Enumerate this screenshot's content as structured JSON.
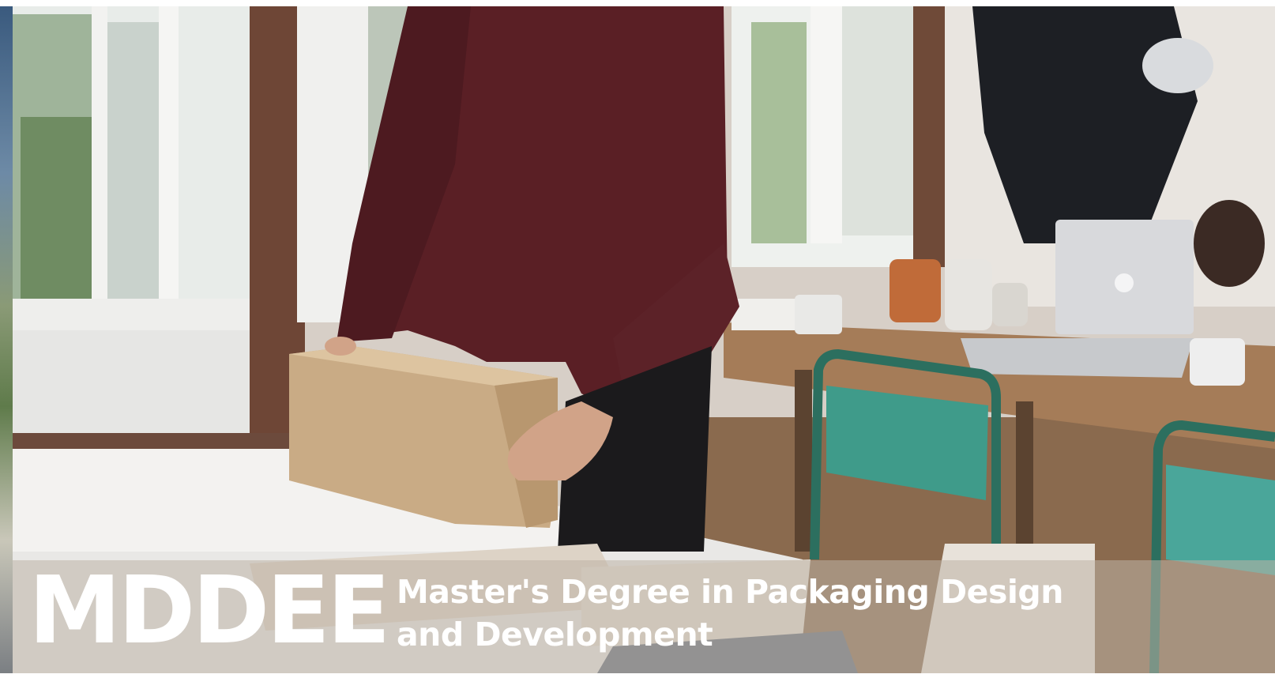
{
  "banner": {
    "brand": "MDDEE",
    "tagline_line1": "Master's Degree in Packaging Design",
    "tagline_line2": "and Development"
  },
  "colors": {
    "shirt": "#5a1f25",
    "box": "#c9ab85",
    "chair": "#3f9b8a",
    "table": "#9a7452",
    "banner_text": "#ffffff"
  }
}
